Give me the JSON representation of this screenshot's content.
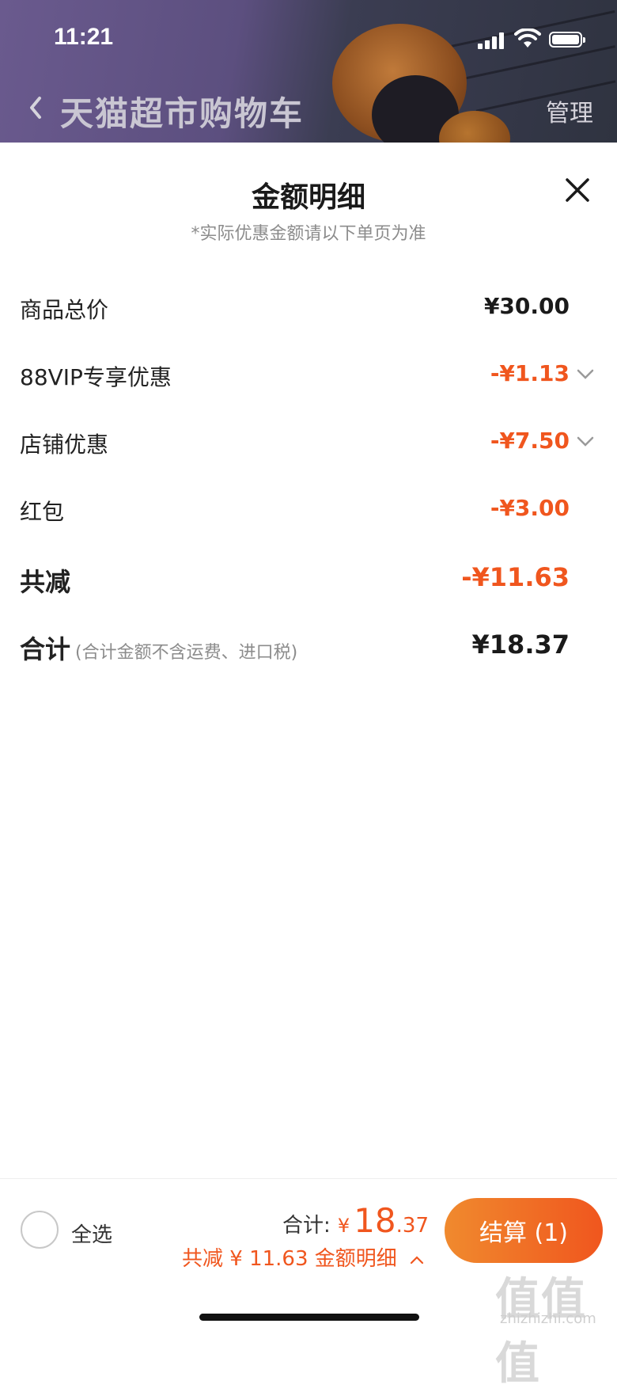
{
  "status_bar": {
    "time": "11:21"
  },
  "header": {
    "title": "天猫超市购物车",
    "manage_label": "管理"
  },
  "sheet": {
    "title": "金额明细",
    "subtitle": "*实际优惠金额请以下单页为准",
    "rows": [
      {
        "label": "商品总价",
        "value": "¥30.00"
      },
      {
        "label": "88VIP专享优惠",
        "value": "-¥1.13"
      },
      {
        "label": "店铺优惠",
        "value": "-¥7.50"
      },
      {
        "label": "红包",
        "value": "-¥3.00"
      },
      {
        "label": "共减",
        "value": "-¥11.63"
      },
      {
        "label": "合计",
        "note": "(合计金额不含运费、进口税)",
        "value": "¥18.37"
      }
    ]
  },
  "footer": {
    "select_all_label": "全选",
    "total_label": "合计:",
    "currency": "¥",
    "total_int": "18",
    "total_dec": ".37",
    "savings_text": "共减 ¥ 11.63  金额明细",
    "checkout_label": "结算 (1)"
  },
  "watermark": {
    "logo": "值值值",
    "url": "zhizhizhi.com"
  },
  "colors": {
    "accent": "#f0561e",
    "button_start": "#f08a2e"
  }
}
